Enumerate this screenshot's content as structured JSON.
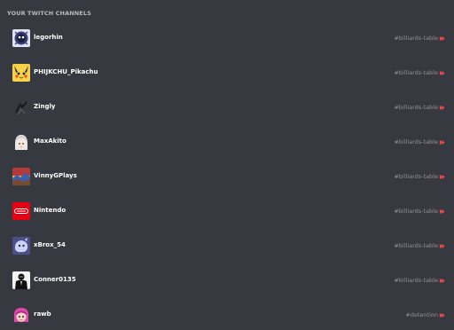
{
  "section_title": "YOUR TWITCH CHANNELS",
  "colors": {
    "background": "#36393f",
    "accent_arrow": "#f04747"
  },
  "channels": [
    {
      "name": "legorhin",
      "target": "#billiards-table",
      "avatar_icon": "dark-creature-avatar-icon"
    },
    {
      "name": "PHIJKCHU_Pikachu",
      "target": "#billiards-table",
      "avatar_icon": "pikachu-avatar-icon"
    },
    {
      "name": "Zingly",
      "target": "#billiards-table",
      "avatar_icon": "sketch-figure-avatar-icon"
    },
    {
      "name": "MaxAkito",
      "target": "#billiards-table",
      "avatar_icon": "anime-face-avatar-icon"
    },
    {
      "name": "VinnyGPlays",
      "target": "#billiards-table",
      "avatar_icon": "landscape-avatar-icon"
    },
    {
      "name": "Nintendo",
      "target": "#billiards-table",
      "avatar_icon": "nintendo-logo-avatar-icon"
    },
    {
      "name": "xBrox_54",
      "target": "#billiards-table",
      "avatar_icon": "purple-blob-avatar-icon"
    },
    {
      "name": "Conner0135",
      "target": "#billiards-table",
      "avatar_icon": "suit-figure-avatar-icon"
    },
    {
      "name": "rawb",
      "target": "#detention",
      "avatar_icon": "pink-character-avatar-icon"
    }
  ]
}
